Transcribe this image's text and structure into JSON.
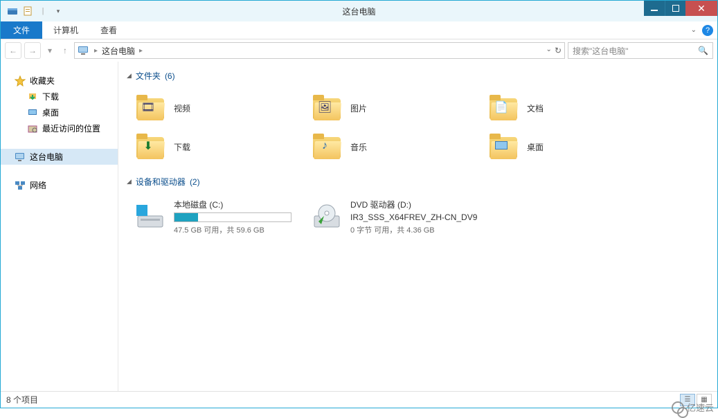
{
  "window": {
    "title": "这台电脑"
  },
  "ribbon": {
    "file": "文件",
    "computer": "计算机",
    "view": "查看"
  },
  "address": {
    "location": "这台电脑"
  },
  "search": {
    "placeholder": "搜索\"这台电脑\""
  },
  "tree": {
    "favorites": "收藏夹",
    "downloads": "下载",
    "desktop": "桌面",
    "recent": "最近访问的位置",
    "thispc": "这台电脑",
    "network": "网络"
  },
  "sections": {
    "folders": {
      "label": "文件夹",
      "count": "(6)"
    },
    "devices": {
      "label": "设备和驱动器",
      "count": "(2)"
    }
  },
  "folders": {
    "videos": "视频",
    "pictures": "图片",
    "documents": "文档",
    "downloads": "下载",
    "music": "音乐",
    "desktop": "桌面"
  },
  "drives": {
    "c": {
      "name": "本地磁盘 (C:)",
      "detail": "47.5 GB 可用，共 59.6 GB",
      "fill_pct": 20
    },
    "d": {
      "name": "DVD 驱动器 (D:)",
      "sub": "IR3_SSS_X64FREV_ZH-CN_DV9",
      "detail": "0 字节 可用，共 4.36 GB"
    }
  },
  "status": {
    "items": "8 个项目"
  },
  "watermark": "亿速云"
}
